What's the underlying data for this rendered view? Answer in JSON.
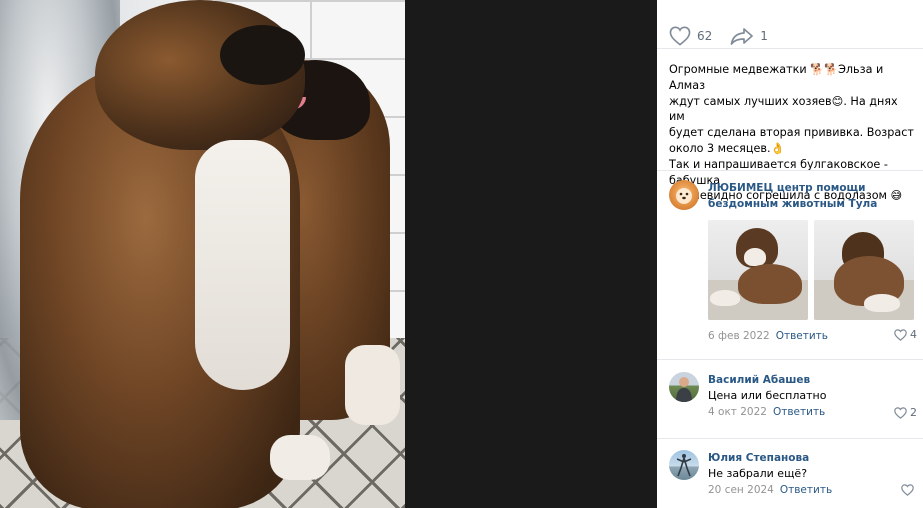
{
  "post": {
    "likes": "62",
    "shares": "1",
    "text_lines": [
      "Огромные медвежатки 🐕🐕Эльза и Алмаз",
      "ждут самых лучших хозяев😊. На днях им",
      "будет сделана вторая прививка. Возраст",
      "около 3 месяцев.👌",
      "Так и напрашивается булгаковское - бабушка",
      "их очевидно согрешила с водолазом 😅"
    ]
  },
  "comments": [
    {
      "author_line1": "ЛЮБИМЕЦ центр помощи",
      "author_line2": "бездомным животным Тула",
      "text": "",
      "date": "6 фев 2022",
      "reply": "Ответить",
      "likes": "4"
    },
    {
      "author_line1": "Василий Абашев",
      "text": "Цена или бесплатно",
      "date": "4 окт 2022",
      "reply": "Ответить",
      "likes": "2"
    },
    {
      "author_line1": "Юлия Степанова",
      "text": "Не забрали ещё?",
      "date": "20 сен 2024",
      "reply": "Ответить",
      "likes": ""
    }
  ],
  "colors": {
    "link": "#2a5885",
    "meta": "#939393",
    "icon": "#818c99",
    "divider": "#e7e8ec"
  },
  "icons": {
    "like": "heart-icon",
    "share": "share-arrow-icon"
  }
}
